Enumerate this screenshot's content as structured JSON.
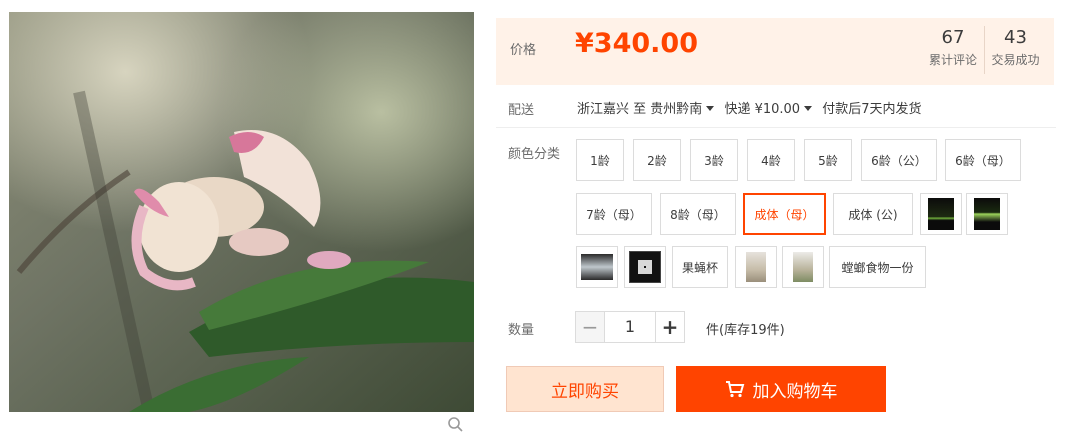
{
  "gallery": {
    "zoom_icon": "magnifier-icon"
  },
  "price": {
    "label": "价格",
    "value": "¥340.00"
  },
  "stats": [
    {
      "number": "67",
      "label": "累计评论"
    },
    {
      "number": "43",
      "label": "交易成功"
    }
  ],
  "shipping": {
    "label": "配送",
    "from": "浙江嘉兴 至",
    "to": "贵州黔南",
    "method": "快递 ¥10.00",
    "dispatch": "付款后7天内发货"
  },
  "sku": {
    "label": "颜色分类",
    "options": [
      "1龄",
      "2龄",
      "3龄",
      "4龄",
      "5龄",
      "6龄（公）",
      "6龄（母）",
      "7龄（母）",
      "8龄（母）",
      "成体（母）",
      "成体 (公)",
      "果蝇杯",
      "螳螂食物一份"
    ],
    "selected": "成体（母）"
  },
  "quantity": {
    "label": "数量",
    "value": "1",
    "stock": "件(库存19件)"
  },
  "buttons": {
    "buy_now": "立即购买",
    "add_to_cart": "加入购物车"
  },
  "colors": {
    "accent": "#ff4400",
    "price_bg": "#fff2e8",
    "buy_bg": "#ffe4d0"
  }
}
